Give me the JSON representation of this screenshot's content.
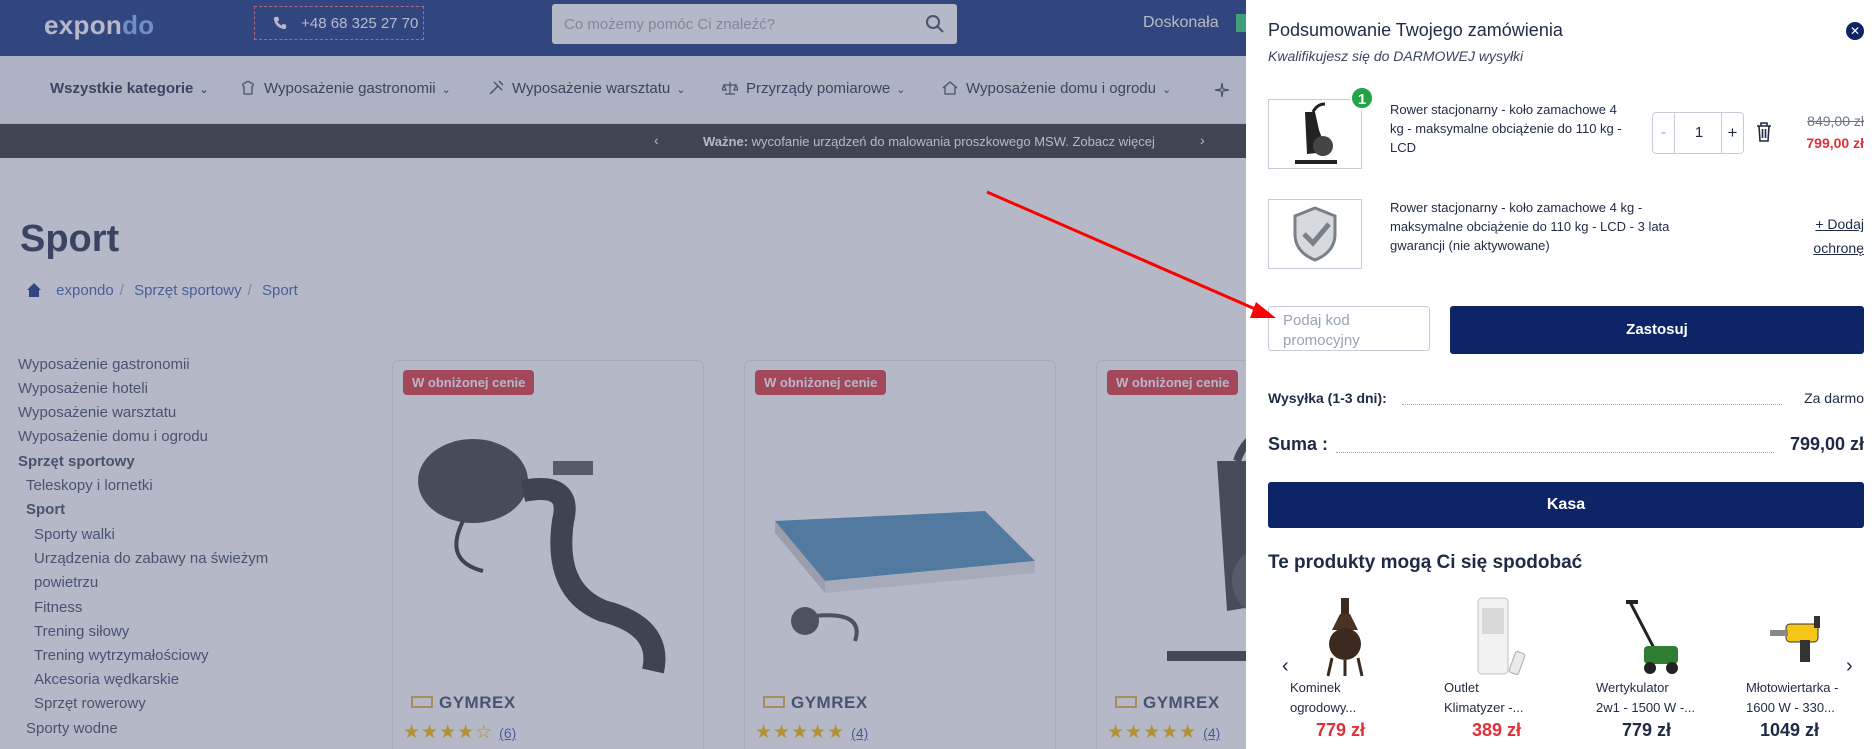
{
  "header": {
    "logo_main": "expon",
    "logo_o": "do",
    "phone": "+48 68 325 27 70",
    "search_placeholder": "Co możemy pomóc Ci znaleźć?",
    "top_right_text": "Doskonała"
  },
  "nav": {
    "items": [
      {
        "label": "Wszystkie kategorie",
        "icon": ""
      },
      {
        "label": "Wyposażenie gastronomii",
        "icon": "chef-icon"
      },
      {
        "label": "Wyposażenie warsztatu",
        "icon": "tools-icon"
      },
      {
        "label": "Przyrządy pomiarowe",
        "icon": "scale-icon"
      },
      {
        "label": "Wyposażenie domu i ogrodu",
        "icon": "house-icon"
      }
    ]
  },
  "promo_bar": {
    "bold": "Ważne:",
    "text": " wycofanie urządzeń do malowania proszkowego MSW. Zobacz więcej"
  },
  "page": {
    "title": "Sport",
    "breadcrumb": [
      "expondo",
      "Sprzęt sportowy",
      "Sport"
    ]
  },
  "sidebar": {
    "items": [
      {
        "label": "Wyposażenie gastronomii",
        "level": 0
      },
      {
        "label": "Wyposażenie hoteli",
        "level": 0
      },
      {
        "label": "Wyposażenie warsztatu",
        "level": 0
      },
      {
        "label": "Wyposażenie domu i ogrodu",
        "level": 0
      },
      {
        "label": "Sprzęt sportowy",
        "level": 0,
        "bold": true
      },
      {
        "label": "Teleskopy i lornetki",
        "level": 1
      },
      {
        "label": "Sport",
        "level": 1,
        "bold": true
      },
      {
        "label": "Sporty walki",
        "level": 2
      },
      {
        "label": "Urządzenia do zabawy na świeżym",
        "level": 2
      },
      {
        "label": "powietrzu",
        "level": 2
      },
      {
        "label": "Fitness",
        "level": 2
      },
      {
        "label": "Trening siłowy",
        "level": 2
      },
      {
        "label": "Trening wytrzymałościowy",
        "level": 2
      },
      {
        "label": "Akcesoria wędkarskie",
        "level": 2
      },
      {
        "label": "Sprzęt rowerowy",
        "level": 2
      },
      {
        "label": "Sporty wodne",
        "level": 1
      }
    ]
  },
  "products": [
    {
      "tag": "W obniżonej cenie",
      "brand": "GYMREX",
      "stars": "★★★★☆",
      "rating_count": "(6)"
    },
    {
      "tag": "W obniżonej cenie",
      "brand": "GYMREX",
      "stars": "★★★★★",
      "rating_count": "(4)"
    },
    {
      "tag": "W obniżonej cenie",
      "brand": "GYMREX",
      "stars": "★★★★★",
      "rating_count": "(4)"
    }
  ],
  "cart": {
    "title": "Podsumowanie Twojego zamówienia",
    "subtitle": "Kwalifikujesz się do DARMOWEJ wysyłki",
    "item": {
      "badge": "1",
      "name_lines": [
        "Rower stacjonarny - koło zamachowe 4",
        "kg - maksymalne obciążenie do 110 kg -",
        "LCD"
      ],
      "quantity": "1",
      "minus": "-",
      "plus": "+",
      "price_old": "849,00 zł",
      "price_new": "799,00 zł"
    },
    "protection": {
      "name_lines": [
        "Rower stacjonarny - koło zamachowe 4 kg -",
        "maksymalne obciążenie do 110 kg - LCD - 3 lata",
        "gwarancji (nie aktywowane)"
      ],
      "add_lines": [
        "+ Dodaj",
        "ochronę"
      ]
    },
    "promo": {
      "placeholder_lines": [
        "Podaj kod",
        "promocyjny"
      ],
      "apply_label": "Zastosuj"
    },
    "shipping": {
      "label": "Wysyłka (1-3 dni):",
      "value": "Za darmo"
    },
    "sum": {
      "label": "Suma :",
      "value": "799,00 zł"
    },
    "checkout_label": "Kasa",
    "reco_title": "Te produkty mogą Ci się spodobać",
    "recommendations": [
      {
        "name_lines": [
          "Kominek",
          "ogrodowy..."
        ],
        "price": "779 zł",
        "price_color": "#e0303a",
        "icon": "chimenea-icon"
      },
      {
        "name_lines": [
          "Outlet",
          "Klimatyzer -..."
        ],
        "price": "389 zł",
        "price_color": "#e0303a",
        "icon": "air-cooler-icon"
      },
      {
        "name_lines": [
          "Wertykulator",
          "2w1 - 1500 W -..."
        ],
        "price": "779 zł",
        "price_color": "#1f2a44",
        "icon": "scarifier-icon"
      },
      {
        "name_lines": [
          "Młotowiertarka -",
          "1600 W - 330..."
        ],
        "price": "1049 zł",
        "price_color": "#1f2a44",
        "icon": "hammer-drill-icon"
      }
    ]
  },
  "colors": {
    "navy": "#0d2466",
    "red_price": "#e0303a",
    "badge_green": "#23a246",
    "annotation_arrow": "#ff0000"
  }
}
